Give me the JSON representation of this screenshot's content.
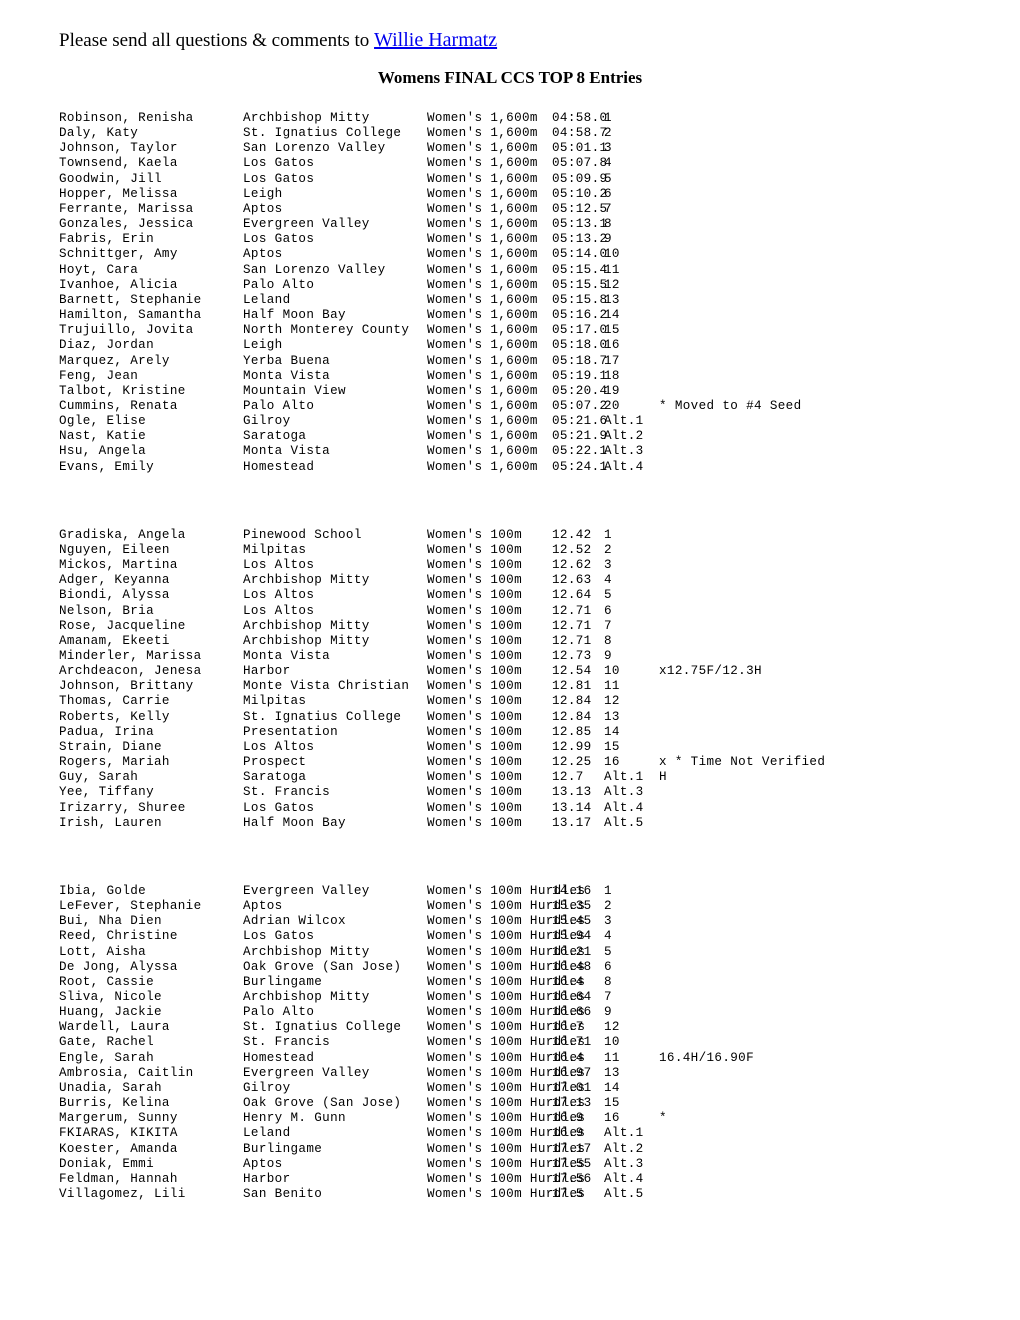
{
  "header": {
    "lead_text": "Please send all questions & comments to ",
    "contact_name": "Willie Harmatz",
    "link_color": "#0000ee"
  },
  "title": "Womens FINAL CCS TOP 8 Entries",
  "blocks": [
    {
      "event_name": "Women's 1,600m",
      "rows": [
        {
          "name": "Robinson, Renisha",
          "school": "Archbishop Mitty",
          "event": "Women's 1,600m",
          "mark": "04:58.0",
          "place": "1",
          "note": ""
        },
        {
          "name": "Daly, Katy",
          "school": "St. Ignatius College",
          "event": "Women's 1,600m",
          "mark": "04:58.7",
          "place": "2",
          "note": ""
        },
        {
          "name": "Johnson, Taylor",
          "school": "San Lorenzo Valley",
          "event": "Women's 1,600m",
          "mark": "05:01.1",
          "place": "3",
          "note": ""
        },
        {
          "name": "Townsend, Kaela",
          "school": "Los Gatos",
          "event": "Women's 1,600m",
          "mark": "05:07.8",
          "place": "4",
          "note": ""
        },
        {
          "name": "Goodwin, Jill",
          "school": "Los Gatos",
          "event": "Women's 1,600m",
          "mark": "05:09.9",
          "place": "5",
          "note": ""
        },
        {
          "name": "Hopper, Melissa",
          "school": "Leigh",
          "event": "Women's 1,600m",
          "mark": "05:10.2",
          "place": "6",
          "note": ""
        },
        {
          "name": "Ferrante, Marissa",
          "school": "Aptos",
          "event": "Women's 1,600m",
          "mark": "05:12.5",
          "place": "7",
          "note": ""
        },
        {
          "name": "Gonzales, Jessica",
          "school": "Evergreen Valley",
          "event": "Women's 1,600m",
          "mark": "05:13.1",
          "place": "8",
          "note": ""
        },
        {
          "name": "Fabris, Erin",
          "school": "Los Gatos",
          "event": "Women's 1,600m",
          "mark": "05:13.2",
          "place": "9",
          "note": ""
        },
        {
          "name": "Schnittger, Amy",
          "school": "Aptos",
          "event": "Women's 1,600m",
          "mark": "05:14.0",
          "place": "10",
          "note": ""
        },
        {
          "name": "Hoyt, Cara",
          "school": "San Lorenzo Valley",
          "event": "Women's 1,600m",
          "mark": "05:15.4",
          "place": "11",
          "note": ""
        },
        {
          "name": "Ivanhoe, Alicia",
          "school": "Palo Alto",
          "event": "Women's 1,600m",
          "mark": "05:15.5",
          "place": "12",
          "note": ""
        },
        {
          "name": "Barnett, Stephanie",
          "school": "Leland",
          "event": "Women's 1,600m",
          "mark": "05:15.8",
          "place": "13",
          "note": ""
        },
        {
          "name": "Hamilton, Samantha",
          "school": "Half Moon Bay",
          "event": "Women's 1,600m",
          "mark": "05:16.2",
          "place": "14",
          "note": ""
        },
        {
          "name": "Trujuillo, Jovita",
          "school": "North Monterey County",
          "event": "Women's 1,600m",
          "mark": "05:17.0",
          "place": "15",
          "note": ""
        },
        {
          "name": "Diaz, Jordan",
          "school": "Leigh",
          "event": "Women's 1,600m",
          "mark": "05:18.0",
          "place": "16",
          "note": ""
        },
        {
          "name": "Marquez, Arely",
          "school": "Yerba Buena",
          "event": "Women's 1,600m",
          "mark": "05:18.7",
          "place": "17",
          "note": ""
        },
        {
          "name": "Feng, Jean",
          "school": "Monta Vista",
          "event": "Women's 1,600m",
          "mark": "05:19.1",
          "place": "18",
          "note": ""
        },
        {
          "name": "Talbot, Kristine",
          "school": "Mountain View",
          "event": "Women's 1,600m",
          "mark": "05:20.4",
          "place": "19",
          "note": ""
        },
        {
          "name": "Cummins, Renata",
          "school": "Palo Alto",
          "event": "Women's 1,600m",
          "mark": "05:07.2",
          "place": "20",
          "note": "* Moved to #4 Seed"
        },
        {
          "name": "Ogle, Elise",
          "school": "Gilroy",
          "event": "Women's 1,600m",
          "mark": "05:21.6",
          "place": "Alt.1",
          "note": ""
        },
        {
          "name": "Nast, Katie",
          "school": "Saratoga",
          "event": "Women's 1,600m",
          "mark": "05:21.9",
          "place": "Alt.2",
          "note": ""
        },
        {
          "name": "Hsu, Angela",
          "school": "Monta Vista",
          "event": "Women's 1,600m",
          "mark": "05:22.1",
          "place": "Alt.3",
          "note": ""
        },
        {
          "name": "Evans, Emily",
          "school": "Homestead",
          "event": "Women's 1,600m",
          "mark": "05:24.1",
          "place": "Alt.4",
          "note": ""
        }
      ]
    },
    {
      "event_name": "Women's 100m",
      "rows": [
        {
          "name": "Gradiska, Angela",
          "school": "Pinewood School",
          "event": "Women's 100m",
          "mark": "12.42",
          "place": "1",
          "note": ""
        },
        {
          "name": "Nguyen, Eileen",
          "school": "Milpitas",
          "event": "Women's 100m",
          "mark": "12.52",
          "place": "2",
          "note": ""
        },
        {
          "name": "Mickos, Martina",
          "school": "Los Altos",
          "event": "Women's 100m",
          "mark": "12.62",
          "place": "3",
          "note": ""
        },
        {
          "name": "Adger, Keyanna",
          "school": "Archbishop Mitty",
          "event": "Women's 100m",
          "mark": "12.63",
          "place": "4",
          "note": ""
        },
        {
          "name": "Biondi, Alyssa",
          "school": "Los Altos",
          "event": "Women's 100m",
          "mark": "12.64",
          "place": "5",
          "note": ""
        },
        {
          "name": "Nelson, Bria",
          "school": "Los Altos",
          "event": "Women's 100m",
          "mark": "12.71",
          "place": "6",
          "note": ""
        },
        {
          "name": "Rose, Jacqueline",
          "school": "Archbishop Mitty",
          "event": "Women's 100m",
          "mark": "12.71",
          "place": "7",
          "note": ""
        },
        {
          "name": "Amanam, Ekeeti",
          "school": "Archbishop Mitty",
          "event": "Women's 100m",
          "mark": "12.71",
          "place": "8",
          "note": ""
        },
        {
          "name": "Minderler, Marissa",
          "school": "Monta Vista",
          "event": "Women's 100m",
          "mark": "12.73",
          "place": "9",
          "note": ""
        },
        {
          "name": "Archdeacon, Jenesa",
          "school": "Harbor",
          "event": "Women's 100m",
          "mark": "12.54",
          "place": "10",
          "note": "x12.75F/12.3H"
        },
        {
          "name": "Johnson, Brittany",
          "school": "Monte Vista Christian",
          "event": "Women's 100m",
          "mark": "12.81",
          "place": "11",
          "note": ""
        },
        {
          "name": "Thomas, Carrie",
          "school": "Milpitas",
          "event": "Women's 100m",
          "mark": "12.84",
          "place": "12",
          "note": ""
        },
        {
          "name": "Roberts, Kelly",
          "school": "St. Ignatius College",
          "event": "Women's 100m",
          "mark": "12.84",
          "place": "13",
          "note": ""
        },
        {
          "name": "Padua, Irina",
          "school": "Presentation",
          "event": "Women's 100m",
          "mark": "12.85",
          "place": "14",
          "note": ""
        },
        {
          "name": "Strain, Diane",
          "school": "Los Altos",
          "event": "Women's 100m",
          "mark": "12.99",
          "place": "15",
          "note": ""
        },
        {
          "name": "Rogers, Mariah",
          "school": "Prospect",
          "event": "Women's 100m",
          "mark": "12.25",
          "place": "16",
          "note": "x * Time Not Verified"
        },
        {
          "name": "Guy, Sarah",
          "school": "Saratoga",
          "event": "Women's 100m",
          "mark": "12.7",
          "place": "Alt.1",
          "note": "H"
        },
        {
          "name": "Yee, Tiffany",
          "school": "St. Francis",
          "event": "Women's 100m",
          "mark": "13.13",
          "place": "Alt.3",
          "note": ""
        },
        {
          "name": "Irizarry, Shuree",
          "school": "Los Gatos",
          "event": "Women's 100m",
          "mark": "13.14",
          "place": "Alt.4",
          "note": ""
        },
        {
          "name": "Irish, Lauren",
          "school": "Half Moon Bay",
          "event": "Women's 100m",
          "mark": "13.17",
          "place": "Alt.5",
          "note": ""
        }
      ]
    },
    {
      "event_name": "Women's 100m Hurdles",
      "rows": [
        {
          "name": "Ibia, Golde",
          "school": "Evergreen Valley",
          "event": "Women's 100m Hurdles",
          "mark": "14.16",
          "place": "1",
          "note": ""
        },
        {
          "name": "LeFever, Stephanie",
          "school": "Aptos",
          "event": "Women's 100m Hurdles",
          "mark": "15.35",
          "place": "2",
          "note": ""
        },
        {
          "name": "Bui, Nha Dien",
          "school": "Adrian Wilcox",
          "event": "Women's 100m Hurdles",
          "mark": "15.45",
          "place": "3",
          "note": ""
        },
        {
          "name": "Reed, Christine",
          "school": "Los Gatos",
          "event": "Women's 100m Hurdles",
          "mark": "15.94",
          "place": "4",
          "note": ""
        },
        {
          "name": "Lott, Aisha",
          "school": "Archbishop Mitty",
          "event": "Women's 100m Hurdles",
          "mark": "16.21",
          "place": "5",
          "note": ""
        },
        {
          "name": "De Jong, Alyssa",
          "school": "Oak Grove (San Jose)",
          "event": "Women's 100m Hurdles",
          "mark": "16.48",
          "place": "6",
          "note": ""
        },
        {
          "name": "Root, Cassie",
          "school": "Burlingame",
          "event": "Women's 100m Hurdles",
          "mark": "16.4",
          "place": "8",
          "note": ""
        },
        {
          "name": "Sliva, Nicole",
          "school": "Archbishop Mitty",
          "event": "Women's 100m Hurdles",
          "mark": "16.64",
          "place": "7",
          "note": ""
        },
        {
          "name": "Huang, Jackie",
          "school": "Palo Alto",
          "event": "Women's 100m Hurdles",
          "mark": "16.66",
          "place": "9",
          "note": ""
        },
        {
          "name": "Wardell, Laura",
          "school": "St. Ignatius College",
          "event": "Women's 100m Hurdles",
          "mark": "16.7",
          "place": "12",
          "note": ""
        },
        {
          "name": "Gate, Rachel",
          "school": "St. Francis",
          "event": "Women's 100m Hurdles",
          "mark": "16.71",
          "place": "10",
          "note": ""
        },
        {
          "name": "Engle, Sarah",
          "school": "Homestead",
          "event": "Women's 100m Hurdles",
          "mark": "16.4",
          "place": "11",
          "note": "16.4H/16.90F"
        },
        {
          "name": "Ambrosia, Caitlin",
          "school": "Evergreen Valley",
          "event": "Women's 100m Hurdles",
          "mark": "16.97",
          "place": "13",
          "note": ""
        },
        {
          "name": "Unadia, Sarah",
          "school": "Gilroy",
          "event": "Women's 100m Hurdles",
          "mark": "17.01",
          "place": "14",
          "note": ""
        },
        {
          "name": "Burris, Kelina",
          "school": "Oak Grove (San Jose)",
          "event": "Women's 100m Hurdles",
          "mark": "17.13",
          "place": "15",
          "note": ""
        },
        {
          "name": "Margerum, Sunny",
          "school": "Henry M. Gunn",
          "event": "Women's 100m Hurdles",
          "mark": "16.9",
          "place": "16",
          "note": "*"
        },
        {
          "name": "FKIARAS, KIKITA",
          "school": "Leland",
          "event": "Women's 100m Hurdles",
          "mark": "16.9",
          "place": "Alt.1",
          "note": ""
        },
        {
          "name": "Koester, Amanda",
          "school": "Burlingame",
          "event": "Women's 100m Hurdles",
          "mark": "17.17",
          "place": "Alt.2",
          "note": ""
        },
        {
          "name": "Doniak, Emmi",
          "school": "Aptos",
          "event": "Women's 100m Hurdles",
          "mark": "17.55",
          "place": "Alt.3",
          "note": ""
        },
        {
          "name": "Feldman, Hannah",
          "school": "Harbor",
          "event": "Women's 100m Hurdles",
          "mark": "17.56",
          "place": "Alt.4",
          "note": ""
        },
        {
          "name": "Villagomez, Lili",
          "school": "San Benito",
          "event": "Women's 100m Hurdles",
          "mark": "17.5",
          "place": "Alt.5",
          "note": ""
        }
      ]
    }
  ]
}
